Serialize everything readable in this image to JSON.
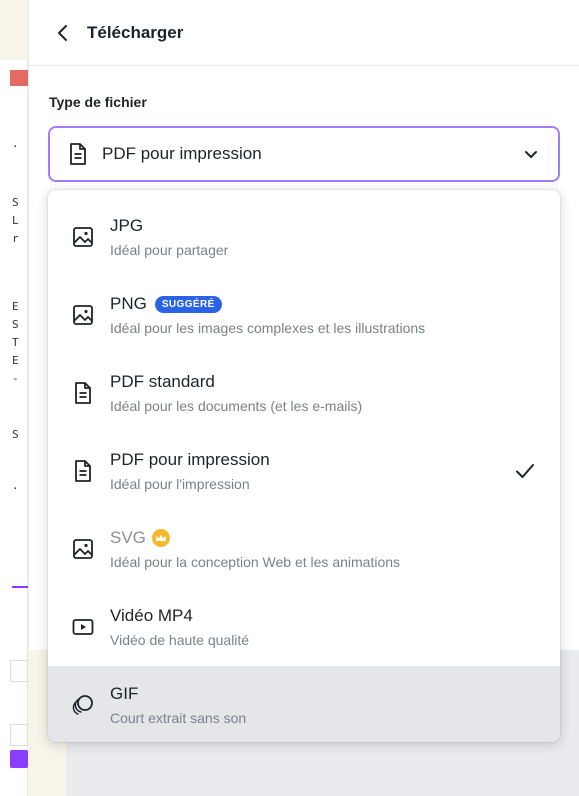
{
  "header": {
    "title": "Télécharger"
  },
  "file_type": {
    "label": "Type de fichier",
    "selected": "PDF pour impression"
  },
  "options": [
    {
      "title": "JPG",
      "description": "Idéal pour partager",
      "icon": "image-icon"
    },
    {
      "title": "PNG",
      "badge": "SUGGÉRÉ",
      "description": "Idéal pour les images complexes et les illustrations",
      "icon": "image-icon"
    },
    {
      "title": "PDF standard",
      "description": "Idéal pour les documents (et les e-mails)",
      "icon": "document-icon"
    },
    {
      "title": "PDF pour impression",
      "description": "Idéal pour l'impression",
      "icon": "document-icon",
      "selected": true
    },
    {
      "title": "SVG",
      "description": "Idéal pour la conception Web et les animations",
      "icon": "image-icon",
      "premium": true
    },
    {
      "title": "Vidéo MP4",
      "description": "Vidéo de haute qualité",
      "icon": "video-icon"
    },
    {
      "title": "GIF",
      "description": "Court extrait sans son",
      "icon": "gif-icon",
      "highlighted": true
    }
  ],
  "colors": {
    "accent": "#8b3dff",
    "select_border": "#a57cf6",
    "badge": "#2a63e6",
    "crown": "#f5b82e",
    "hover": "#e4e6ea"
  }
}
